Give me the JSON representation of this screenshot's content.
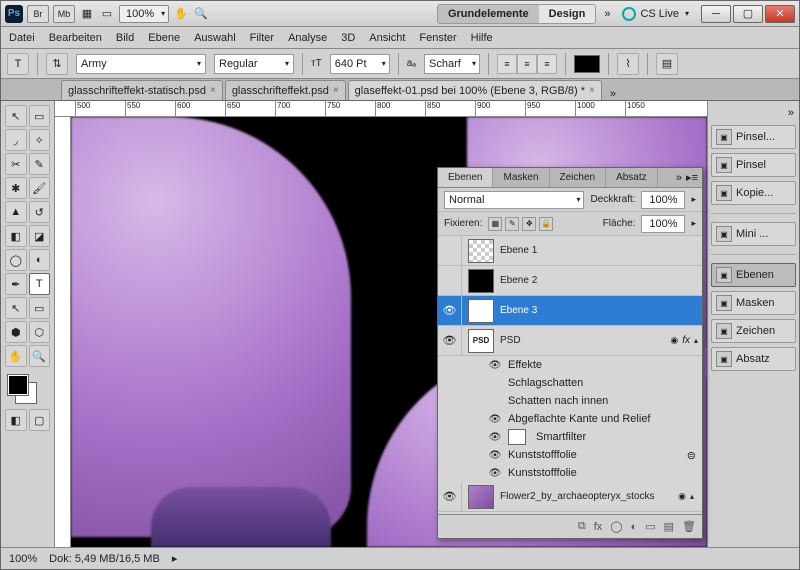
{
  "titlebar": {
    "zoom": "100%",
    "workspace_active": "Grundelemente",
    "workspace_other": "Design",
    "cslive": "CS Live"
  },
  "menu": [
    "Datei",
    "Bearbeiten",
    "Bild",
    "Ebene",
    "Auswahl",
    "Filter",
    "Analyse",
    "3D",
    "Ansicht",
    "Fenster",
    "Hilfe"
  ],
  "options": {
    "font": "Army",
    "style": "Regular",
    "size": "640 Pt",
    "aa_label": "Scharf"
  },
  "tabs": [
    {
      "label": "glasschrifteffekt-statisch.psd",
      "active": false
    },
    {
      "label": "glasschrifteffekt.psd",
      "active": false
    },
    {
      "label": "glaseffekt-01.psd bei 100% (Ebene 3, RGB/8) *",
      "active": true
    }
  ],
  "dock": [
    {
      "label": "Pinsel..."
    },
    {
      "label": "Pinsel"
    },
    {
      "label": "Kopie..."
    },
    {
      "label": "Mini ..."
    },
    {
      "label": "Ebenen",
      "active": true
    },
    {
      "label": "Masken"
    },
    {
      "label": "Zeichen"
    },
    {
      "label": "Absatz"
    }
  ],
  "panel": {
    "tabs": [
      "Ebenen",
      "Masken",
      "Zeichen",
      "Absatz"
    ],
    "blend": "Normal",
    "opacity_label": "Deckkraft:",
    "opacity": "100%",
    "lock_label": "Fixieren:",
    "fill_label": "Fläche:",
    "fill": "100%",
    "layers": [
      {
        "name": "Ebene 1",
        "thumb": "checker"
      },
      {
        "name": "Ebene 2",
        "thumb": "black"
      },
      {
        "name": "Ebene 3",
        "thumb": "psd",
        "vis": true,
        "sel": true
      },
      {
        "name": "PSD",
        "thumb": "psd",
        "vis": true,
        "fx": true
      }
    ],
    "effects_label": "Effekte",
    "fx": [
      "Schlagschatten",
      "Schatten nach innen",
      "Abgeflachte Kante und Relief"
    ],
    "smart_label": "Smartfilter",
    "smartfilters": [
      "Kunststofffolie",
      "Kunststofffolie"
    ],
    "bg_layer": "Flower2_by_archaeopteryx_stocks"
  },
  "status": {
    "zoom": "100%",
    "doc": "Dok: 5,49 MB/16,5 MB"
  },
  "ruler_ticks": [
    "500",
    "550",
    "600",
    "650",
    "700",
    "750",
    "800",
    "850",
    "900",
    "950",
    "1000",
    "1050"
  ]
}
